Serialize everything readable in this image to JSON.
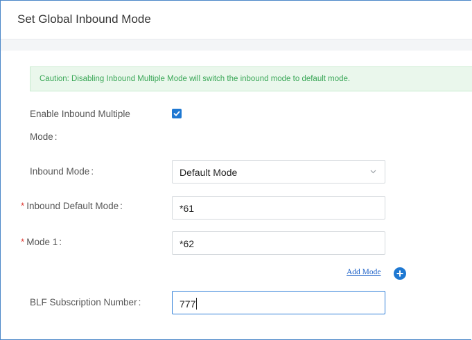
{
  "panel": {
    "title": "Set Global Inbound Mode"
  },
  "caution": {
    "text": "Caution: Disabling Inbound Multiple Mode will switch the inbound mode to default mode."
  },
  "form": {
    "enable_multiple": {
      "label_line1": "Enable Inbound Multiple",
      "label_line2": "Mode",
      "colon": ":",
      "checked": true
    },
    "inbound_mode": {
      "label": "Inbound Mode",
      "colon": ":",
      "selected": "Default Mode",
      "icon": "chevron-down-icon"
    },
    "inbound_default_mode": {
      "required_mark": "*",
      "label": "Inbound Default Mode",
      "colon": ":",
      "value": "*61"
    },
    "mode_1": {
      "required_mark": "*",
      "label": "Mode 1",
      "colon": ":",
      "value": "*62"
    },
    "add_mode": {
      "label": "Add Mode",
      "icon": "plus-circle-icon"
    },
    "blf_subscription": {
      "label": "BLF Subscription Number",
      "colon": ":",
      "value": "777"
    }
  },
  "colors": {
    "accent": "#1e78d2",
    "caution_bg": "#eaf7ec",
    "caution_text": "#3aa757",
    "required": "#e0403a"
  }
}
